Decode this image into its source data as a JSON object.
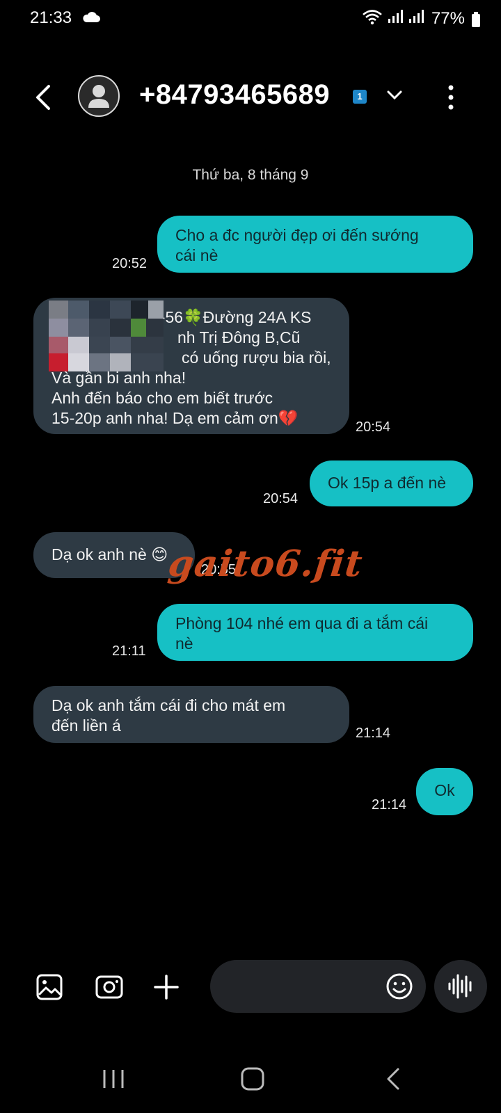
{
  "status_bar": {
    "time": "21:33",
    "battery": "77%",
    "icons": [
      "cloud-icon",
      "wifi-icon",
      "signal-icon",
      "battery-icon"
    ]
  },
  "header": {
    "contact": "+84793465689",
    "sim": "1",
    "icons": [
      "back-icon",
      "avatar-icon",
      "chevron-down-icon",
      "more-vert-icon"
    ]
  },
  "date_separator": "Thứ ba, 8 tháng 9",
  "messages": [
    {
      "direction": "out",
      "lines": [
        "Cho a đc người đẹp ơi  đến sướng",
        "cái nè"
      ],
      "time": "20:52"
    },
    {
      "direction": "in",
      "lines": [
        "4-56🍀Đường 24A KS",
        "nh Trị Đông B,Cũ",
        "có uống rượu bia rồi,",
        "Và gần bi anh nha!",
        "Anh đến báo cho em biết trước",
        "15-20p anh nha! Dạ em cảm ơn💔"
      ],
      "time": "20:54"
    },
    {
      "direction": "out",
      "lines": [
        "Ok 15p a đến nè"
      ],
      "time": "20:54"
    },
    {
      "direction": "in",
      "lines": [
        "Dạ ok anh nè 😊"
      ],
      "time": "20:55"
    },
    {
      "direction": "out",
      "lines": [
        "Phòng 104 nhé em  qua đi a tắm cái",
        "nè"
      ],
      "time": "21:11"
    },
    {
      "direction": "in",
      "lines": [
        "Dạ ok anh tắm cái đi cho mát em",
        "đến liền á"
      ],
      "time": "21:14"
    },
    {
      "direction": "out",
      "lines": [
        "Ok"
      ],
      "time": "21:14"
    }
  ],
  "watermark": "gaito6.fit",
  "composer": {
    "placeholder": "",
    "icons": [
      "gallery-icon",
      "camera-icon",
      "plus-icon",
      "emoji-icon",
      "voice-icon"
    ]
  },
  "navbar": {
    "icons": [
      "recents-icon",
      "home-icon",
      "back-nav-icon"
    ]
  },
  "colors": {
    "outgoing": "#16c0c5",
    "incoming": "#2e3a44",
    "background": "#000000"
  }
}
